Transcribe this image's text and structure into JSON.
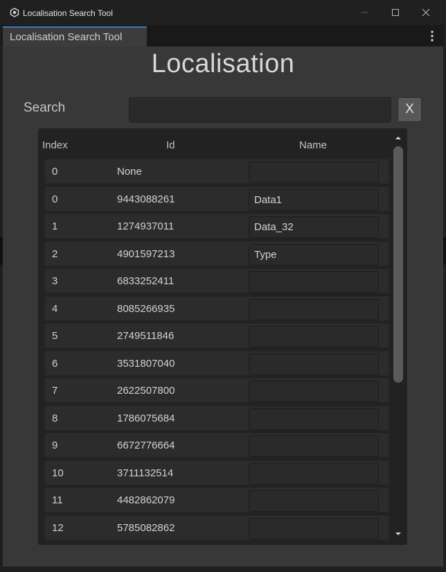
{
  "window": {
    "title": "Localisation Search Tool",
    "controls": {
      "minimize": "—",
      "maximize": "☐",
      "close": "✕"
    }
  },
  "tab": {
    "label": "Localisation Search Tool"
  },
  "heading": "Localisation",
  "search": {
    "label": "Search",
    "value": "",
    "clear_label": "X"
  },
  "table": {
    "headers": {
      "index": "Index",
      "id": "Id",
      "name": "Name"
    },
    "rows": [
      {
        "index": "0",
        "id": "None",
        "name": ""
      },
      {
        "index": "0",
        "id": "9443088261",
        "name": "Data1"
      },
      {
        "index": "1",
        "id": "1274937011",
        "name": "Data_32"
      },
      {
        "index": "2",
        "id": "4901597213",
        "name": "Type"
      },
      {
        "index": "3",
        "id": "6833252411",
        "name": ""
      },
      {
        "index": "4",
        "id": "8085266935",
        "name": ""
      },
      {
        "index": "5",
        "id": "2749511846",
        "name": ""
      },
      {
        "index": "6",
        "id": "3531807040",
        "name": ""
      },
      {
        "index": "7",
        "id": "2622507800",
        "name": ""
      },
      {
        "index": "8",
        "id": "1786075684",
        "name": ""
      },
      {
        "index": "9",
        "id": "6672776664",
        "name": ""
      },
      {
        "index": "10",
        "id": "3711132514",
        "name": ""
      },
      {
        "index": "11",
        "id": "4482862079",
        "name": ""
      },
      {
        "index": "12",
        "id": "5785082862",
        "name": ""
      }
    ]
  },
  "icons": {
    "app": "unity-icon",
    "menu": "kebab-menu-icon",
    "scroll_up": "triangle-up-icon",
    "scroll_down": "triangle-down-icon"
  },
  "colors": {
    "panel": "#383838",
    "tab_accent": "#3a79bb",
    "table_bg": "#222222",
    "row_bg": "#2c2c2c"
  }
}
